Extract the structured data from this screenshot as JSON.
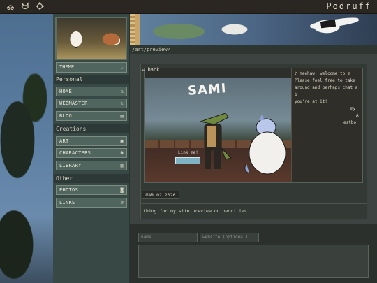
{
  "topbar": {
    "site_name": "Podruff",
    "icons": [
      "webring-icon",
      "cat-icon",
      "crosshair-icon"
    ]
  },
  "sidebar": {
    "theme_select": {
      "label": "THEME",
      "selected": "THEME"
    },
    "sections": [
      {
        "label": "Personal",
        "items": [
          {
            "label": "HOME",
            "icon": "home-icon"
          },
          {
            "label": "WEBMASTER",
            "icon": "person-icon"
          },
          {
            "label": "BLOG",
            "icon": "blog-icon"
          }
        ]
      },
      {
        "label": "Creations",
        "items": [
          {
            "label": "ART",
            "icon": "image-icon"
          },
          {
            "label": "CHARACTERS",
            "icon": "group-icon"
          },
          {
            "label": "LIBRARY",
            "icon": "book-icon"
          }
        ]
      },
      {
        "label": "Other",
        "items": [
          {
            "label": "PHOTOS",
            "icon": "camera-icon"
          },
          {
            "label": "LINKS",
            "icon": "link-icon"
          }
        ]
      }
    ]
  },
  "main": {
    "path": "/art/preview/",
    "back_label": "back",
    "preview": {
      "title_text": "SAMI",
      "link_me_label": "Link me!",
      "note_lines": [
        "♪ Yeehaw, welcome to m",
        "Please feel free to take",
        "around and perhaps chat a b",
        "you're at it!",
        "my",
        "A",
        "estbo"
      ]
    },
    "date": "MAR 02 2026",
    "caption": "thing for my site preview on neocities"
  },
  "comment_form": {
    "name_placeholder": "name",
    "website_placeholder": "website (optional)",
    "comment_placeholder": ""
  },
  "colors": {
    "sidebar_bg": "#384845",
    "nav_item_bg": "#51655f",
    "section_label_bg": "#2c3937",
    "panel_bg": "#3d4340"
  }
}
